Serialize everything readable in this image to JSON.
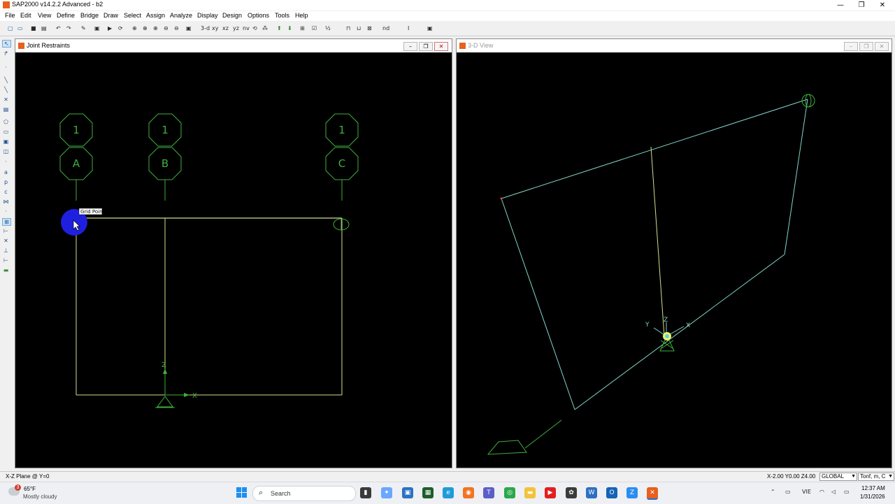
{
  "window": {
    "title": "SAP2000 v14.2.2 Advanced  - b2",
    "controls": {
      "minimize": "—",
      "restore": "❐",
      "close": "✕"
    }
  },
  "menu": [
    "File",
    "Edit",
    "View",
    "Define",
    "Bridge",
    "Draw",
    "Select",
    "Assign",
    "Analyze",
    "Display",
    "Design",
    "Options",
    "Tools",
    "Help"
  ],
  "toolbar": {
    "view_labels": [
      "3-d",
      "xy",
      "xz",
      "yz",
      "nv"
    ],
    "snap_label": "nd"
  },
  "left_panel": {
    "title": "Joint Restraints",
    "grid_bubbles_top": [
      "1",
      "1",
      "1"
    ],
    "grid_bubbles_bottom": [
      "A",
      "B",
      "C"
    ],
    "tooltip": "Grid Point",
    "axis_z": "Z",
    "axis_x": "X"
  },
  "right_panel": {
    "title": "3-D View",
    "axis_labels": {
      "z": "Z",
      "x": "X",
      "y": "Y"
    }
  },
  "status": {
    "left": "X-Z Plane @ Y=0",
    "coords": "X-2.00  Y0.00  Z4.00",
    "coord_system": "GLOBAL",
    "units": "Tonf, m, C"
  },
  "taskbar": {
    "weather_badge": "3",
    "temperature": "65°F",
    "weather": "Mostly cloudy",
    "search_placeholder": "Search",
    "language": "VIE",
    "time": "12:37 AM",
    "date": "1/31/2026"
  },
  "colors": {
    "cad_background": "#000000",
    "grid_green": "#3fae3f",
    "frame_yellow": "#d7dc8e",
    "frame_cyan": "#7fd6c8",
    "cursor_blue": "#1f1fe0",
    "app_orange": "#e8601c"
  }
}
